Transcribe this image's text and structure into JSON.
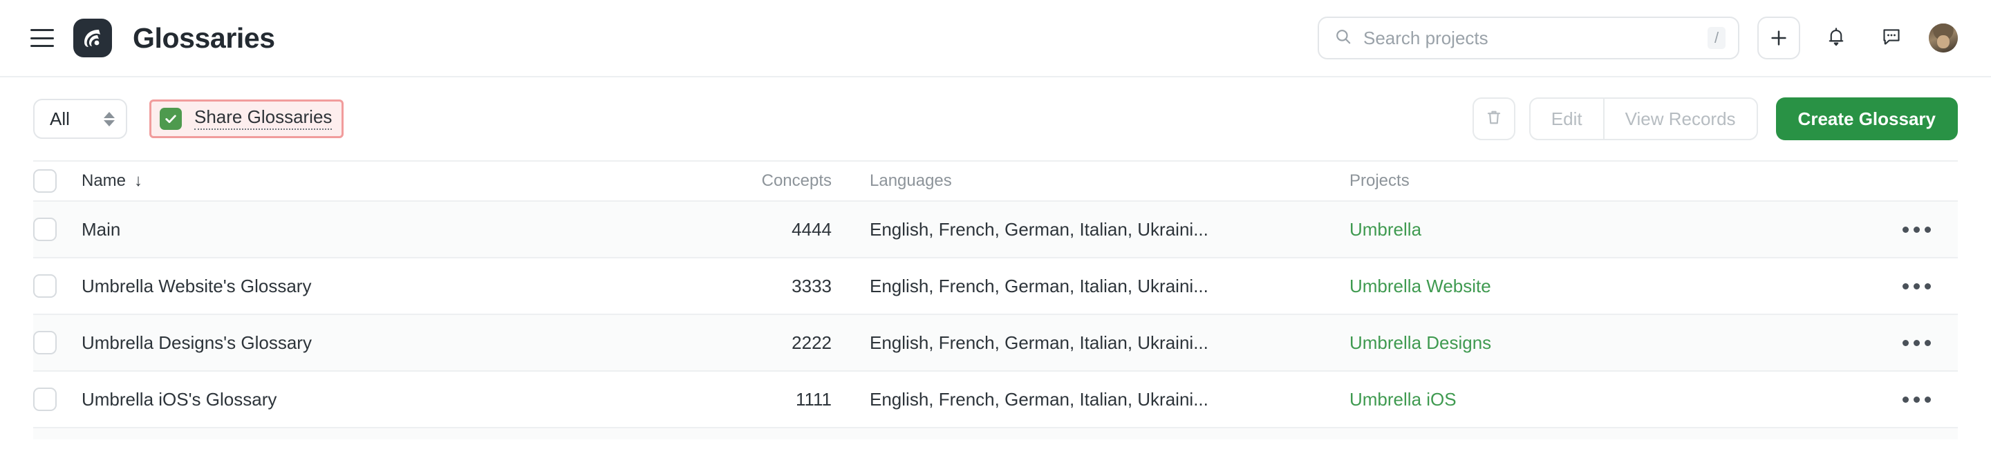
{
  "header": {
    "menu_icon": "hamburger-icon",
    "logo_icon": "app-logo-icon",
    "title": "Glossaries",
    "search": {
      "icon": "search-icon",
      "placeholder": "Search projects",
      "value": "",
      "shortcut": "/"
    },
    "add_button_label": "+",
    "notifications_icon": "bell-icon",
    "messages_icon": "chat-bubble-icon",
    "avatar_icon": "user-avatar"
  },
  "toolbar": {
    "filter_value": "All",
    "filter_icon": "chevron-updown-icon",
    "share_checkbox_checked": true,
    "share_label": "Share Glossaries",
    "delete_icon": "trash-icon",
    "edit_label": "Edit",
    "view_records_label": "View Records",
    "create_label": "Create Glossary",
    "highlight_color": "#f19c9c",
    "accent_color": "#299245"
  },
  "table": {
    "columns": {
      "name": "Name",
      "sort_indicator": "↓",
      "concepts": "Concepts",
      "languages": "Languages",
      "projects": "Projects"
    },
    "rows": [
      {
        "name": "Main",
        "concepts": "4444",
        "languages": "English, French, German, Italian, Ukraini...",
        "project": "Umbrella",
        "menu_icon": "more-options-icon"
      },
      {
        "name": "Umbrella Website's Glossary",
        "concepts": "3333",
        "languages": "English, French, German, Italian, Ukraini...",
        "project": "Umbrella Website",
        "menu_icon": "more-options-icon"
      },
      {
        "name": "Umbrella Designs's Glossary",
        "concepts": "2222",
        "languages": "English, French, German, Italian, Ukraini...",
        "project": "Umbrella Designs",
        "menu_icon": "more-options-icon"
      },
      {
        "name": "Umbrella iOS's Glossary",
        "concepts": "1111",
        "languages": "English, French, German, Italian, Ukraini...",
        "project": "Umbrella iOS",
        "menu_icon": "more-options-icon"
      }
    ]
  }
}
